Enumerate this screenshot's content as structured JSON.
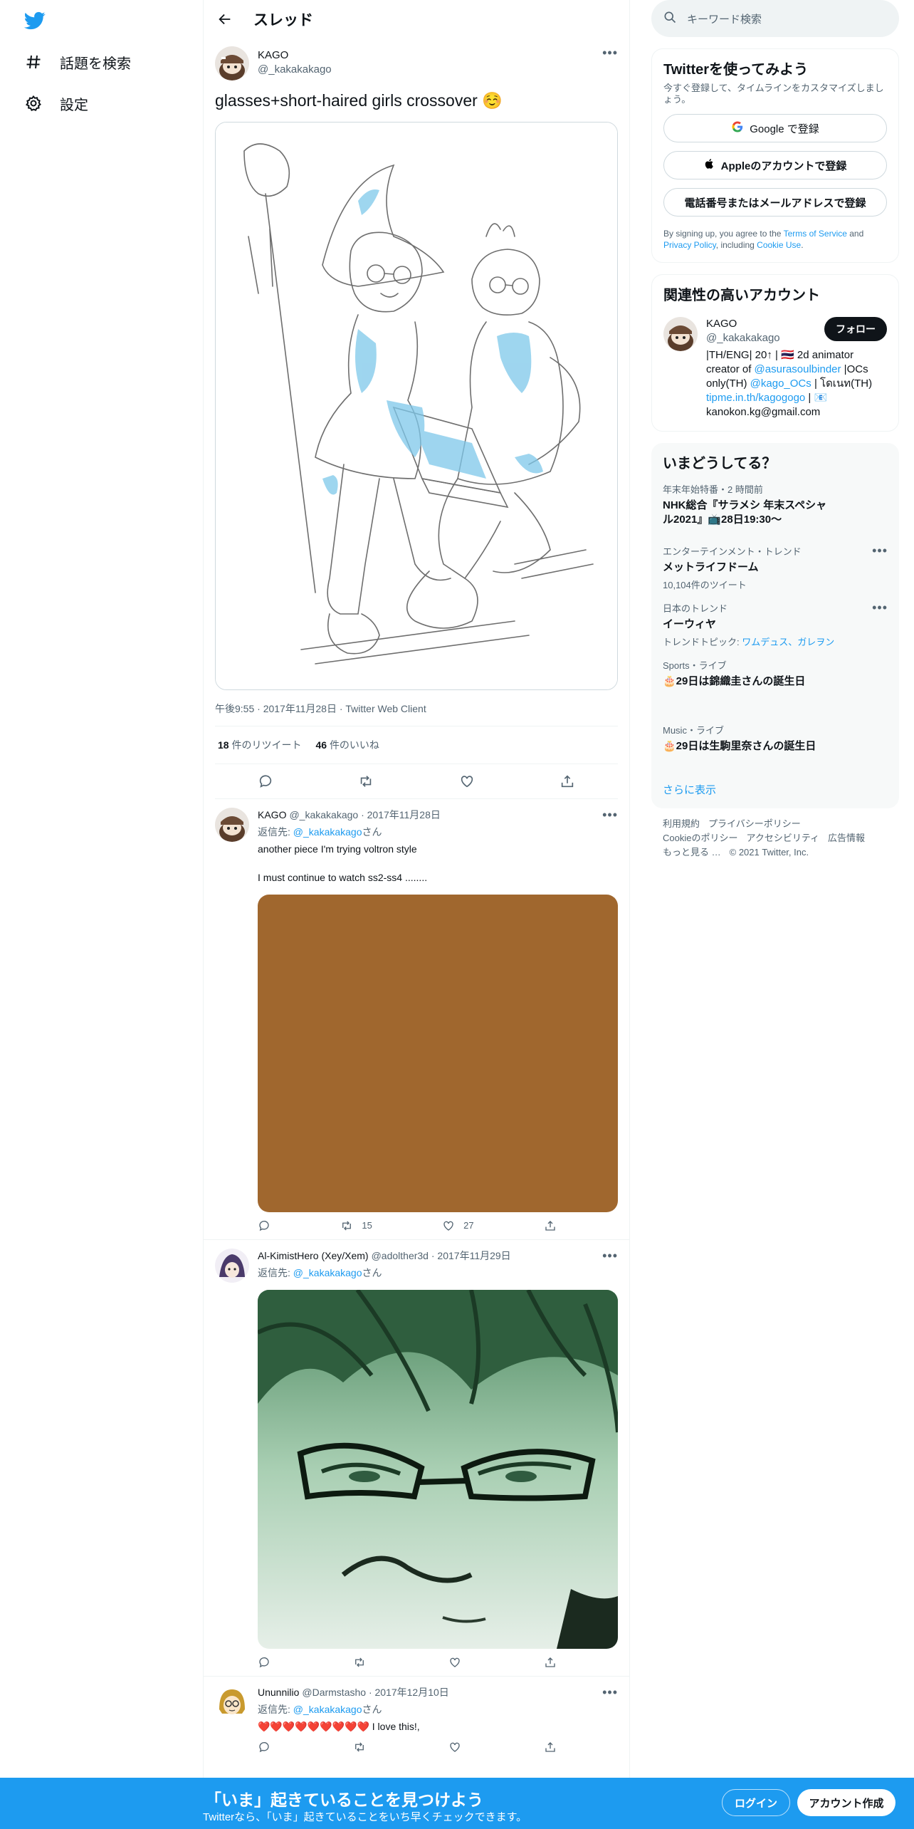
{
  "nav": {
    "explore_label": "話題を検索",
    "settings_label": "設定"
  },
  "header": {
    "title": "スレッド"
  },
  "focus_tweet": {
    "name": "KAGO",
    "handle": "@_kakakakago",
    "text": "glasses+short-haired girls crossover ☺️",
    "meta": "午後9:55 · 2017年11月28日 · Twitter Web Client",
    "retweets": "18",
    "retweets_label": "件のリツイート",
    "likes": "46",
    "likes_label": "件のいいね"
  },
  "replies": [
    {
      "name": "KAGO",
      "handle": "@_kakakakago",
      "date": "· 2017年11月28日",
      "reply_prefix": "返信先: ",
      "reply_to": "@_kakakakago",
      "reply_suffix": "さん",
      "text": "another piece I'm trying voltron style\n\nI must continue to watch ss2-ss4 ........",
      "retweets": "15",
      "likes": "27",
      "media_color": "#a0672e"
    },
    {
      "name": "Al-KimistHero (Xey/Xem)",
      "handle": "@adolther3d",
      "date": "· 2017年11月29日",
      "reply_prefix": "返信先: ",
      "reply_to": "@_kakakakago",
      "reply_suffix": "さん",
      "text": "",
      "retweets": "",
      "likes": ""
    },
    {
      "name": "Ununnilio",
      "handle": "@Darmstasho",
      "date": "· 2017年12月10日",
      "reply_prefix": "返信先: ",
      "reply_to": "@_kakakakago",
      "reply_suffix": "さん",
      "text": "❤️❤️❤️❤️❤️❤️❤️❤️❤️ I love this!,",
      "retweets": "",
      "likes": ""
    }
  ],
  "search": {
    "placeholder": "キーワード検索"
  },
  "signup": {
    "title": "Twitterを使ってみよう",
    "subtitle": "今すぐ登録して、タイムラインをカスタマイズしましょう。",
    "google": "Google で登録",
    "apple": "Appleのアカウントで登録",
    "phone": "電話番号またはメールアドレスで登録",
    "terms_prefix": "By signing up, you agree to the ",
    "terms_tos": "Terms of Service",
    "terms_and": " and ",
    "terms_privacy": "Privacy Policy",
    "terms_including": ", including ",
    "terms_cookie": "Cookie Use",
    "terms_end": "."
  },
  "related": {
    "title": "関連性の高いアカウント",
    "name": "KAGO",
    "handle": "@_kakakakago",
    "follow": "フォロー",
    "bio_1": "|TH/ENG| 20↑ | 🇹🇭 2d animator",
    "bio_2a": "creator of ",
    "bio_2link": "@asurasoulbinder",
    "bio_2b": " |OCs",
    "bio_3a": "only(TH) ",
    "bio_3link": "@kago_OCs",
    "bio_3b": " | โดเนท(TH)",
    "bio_4link": "tipme.in.th/kagogogo",
    "bio_4b": " | 📧",
    "bio_5": "kanokon.kg@gmail.com"
  },
  "trends": {
    "title": "いまどうしてる？",
    "items": [
      {
        "ctx": "年末年始特番・2 時間前",
        "title": "NHK総合『サラメシ 年末スペシャル2021』📺28日19:30〜",
        "count": ""
      },
      {
        "ctx": "エンターテインメント・トレンド",
        "title": "メットライフドーム",
        "count": "10,104件のツイート"
      },
      {
        "ctx": "日本のトレンド",
        "title": "イーウィヤ",
        "count_prefix": "トレンドトピック: ",
        "count_links": "ワムデュス、ガレヲン"
      },
      {
        "ctx": "Sports・ライブ",
        "title": "🎂29日は錦織圭さんの誕生日"
      },
      {
        "ctx": "Music・ライブ",
        "title": "🎂29日は生駒里奈さんの誕生日"
      }
    ],
    "show_more": "さらに表示"
  },
  "footer": {
    "l1": "利用規約",
    "l2": "プライバシーポリシー",
    "l3": "Cookieのポリシー",
    "l4": "アクセシビリティ",
    "l5": "広告情報",
    "l6": "もっと見る …",
    "copy": "© 2021 Twitter, Inc."
  },
  "bottom_bar": {
    "title": "「いま」起きていることを見つけよう",
    "subtitle": "Twitterなら、「いま」起きていることをいち早くチェックできます。",
    "login": "ログイン",
    "signup": "アカウント作成"
  },
  "colors": {
    "accent": "#1d9bf0",
    "text": "#0f1419",
    "muted": "#536471"
  }
}
